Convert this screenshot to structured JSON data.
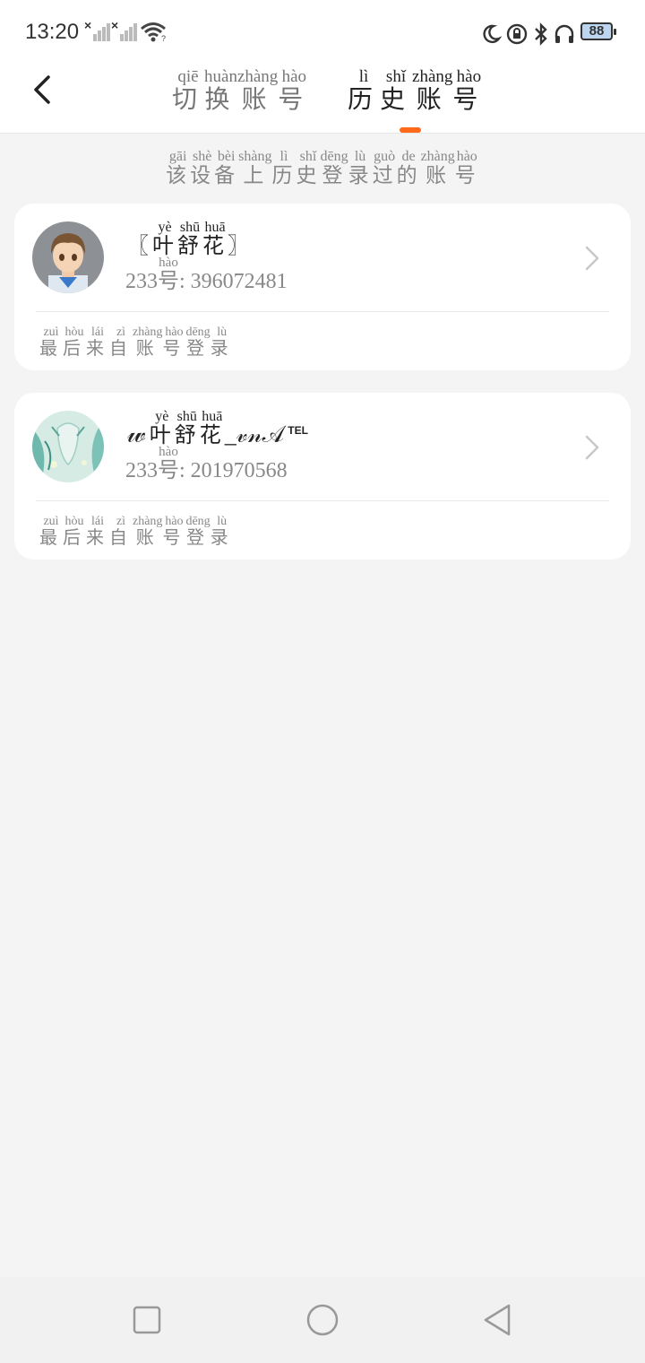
{
  "status": {
    "time": "13:20",
    "battery": "88"
  },
  "header": {
    "back_icon": "chevron-left-icon",
    "tabs": [
      {
        "chars": [
          "切",
          "换",
          "账",
          "号"
        ],
        "pinyin": [
          "qiē",
          "huàn",
          "zhàng",
          "hào"
        ]
      },
      {
        "chars": [
          "历",
          "史",
          "账",
          "号"
        ],
        "pinyin": [
          "lì",
          "shǐ",
          "zhàng",
          "hào"
        ]
      }
    ],
    "active_tab": 1,
    "accent": "#ff6a1a"
  },
  "hint": {
    "chars": [
      "该",
      "设",
      "备",
      "上",
      "历",
      "史",
      "登",
      "录",
      "过",
      "的",
      "账",
      "号"
    ],
    "pinyin": [
      "gāi",
      "shè",
      "bèi",
      "shàng",
      "lì",
      "shǐ",
      "dēng",
      "lù",
      "guò",
      "de",
      "zhàng",
      "hào"
    ]
  },
  "accounts": [
    {
      "name_prefix": "〖",
      "name_chars": [
        "叶",
        "舒",
        "花"
      ],
      "name_pinyin": [
        "yè",
        "shū",
        "huā"
      ],
      "name_suffix": "〗",
      "uid_prefix": "233",
      "uid_char": "号",
      "uid_pinyin": "hào",
      "uid_value": ": 396072481",
      "last_chars": [
        "最",
        "后",
        "来",
        "自",
        "账",
        "号",
        "登",
        "录"
      ],
      "last_pinyin": [
        "zuì",
        "hòu",
        "lái",
        "zì",
        "zhàng",
        "hào",
        "dēng",
        "lù"
      ]
    },
    {
      "name_prefix": "𝓌",
      "name_chars": [
        "叶",
        "舒",
        "花"
      ],
      "name_pinyin": [
        "yè",
        "shū",
        "huā"
      ],
      "name_suffix": "_𝓋𝓃𝒜",
      "name_sup": "TEL",
      "uid_prefix": "233",
      "uid_char": "号",
      "uid_pinyin": "hào",
      "uid_value": ": 201970568",
      "last_chars": [
        "最",
        "后",
        "来",
        "自",
        "账",
        "号",
        "登",
        "录"
      ],
      "last_pinyin": [
        "zuì",
        "hòu",
        "lái",
        "zì",
        "zhàng",
        "hào",
        "dēng",
        "lù"
      ]
    }
  ]
}
